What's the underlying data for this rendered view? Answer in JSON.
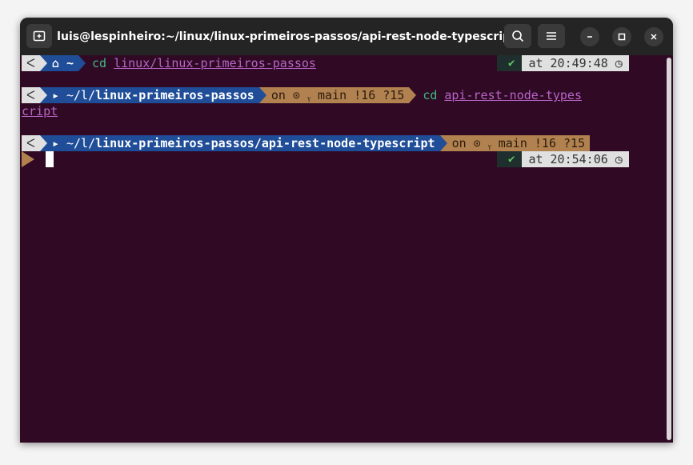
{
  "window": {
    "title": "luis@lespinheiro:~/linux/linux-primeiros-passos/api-rest-node-typescript",
    "new_tab_icon": "new-tab-icon",
    "search_icon": "search-icon",
    "menu_icon": "hamburger-menu-icon",
    "minimize_icon": "minimize-icon",
    "maximize_icon": "maximize-icon",
    "close_icon": "close-icon"
  },
  "terminal": {
    "colors": {
      "background": "#300a24",
      "dir_segment": "#1f4d98",
      "git_segment": "#b1824f",
      "os_segment": "#e0e0e0",
      "command": "#3fb984",
      "path": "#b865c9",
      "ok_check": "#5cc766"
    },
    "prompt1": {
      "os_icon": "ᐸ",
      "dir": "⌂ ~",
      "command": "cd",
      "argument": "linux/linux-primeiros-passos",
      "status": "✔",
      "time": "at 20:49:48 ◷"
    },
    "prompt2": {
      "os_icon": "ᐸ",
      "dir_prefix": "▸ ~/l/",
      "dir_name": "linux-primeiros-passos",
      "git": "on ⊙ ᵧ main !16 ?15",
      "command": "cd",
      "argument_line1": "api-rest-node-types",
      "argument_line2": "cript"
    },
    "prompt3": {
      "os_icon": "ᐸ",
      "dir_prefix": "▸ ~/l/",
      "dir_name": "linux-primeiros-passos/api-rest-node-typescript",
      "git": "on ⊙ ᵧ main !16 ?15",
      "status": "✔",
      "time": "at 20:54:06 ◷"
    }
  }
}
